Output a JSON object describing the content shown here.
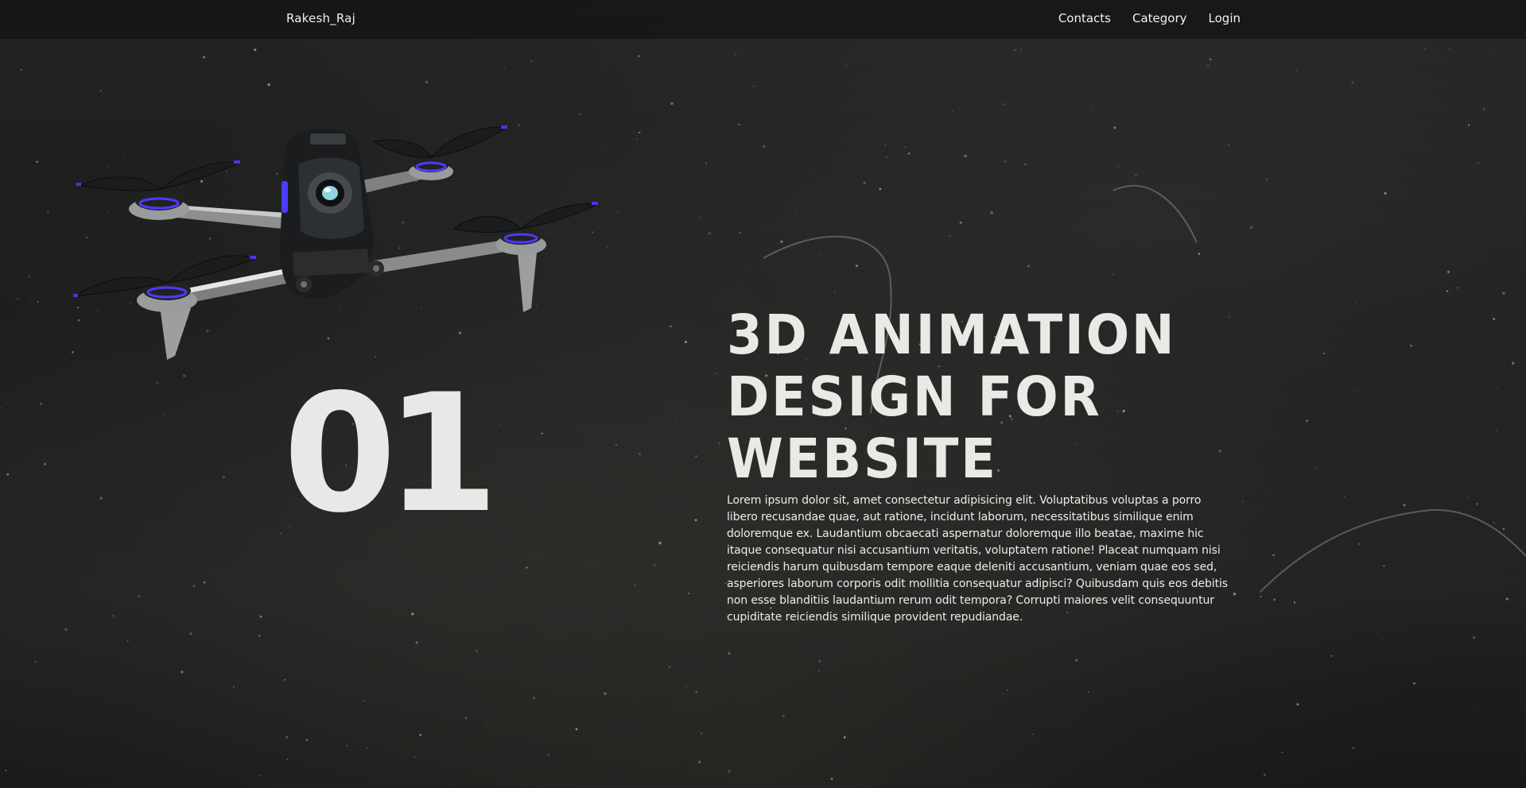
{
  "nav": {
    "brand": "Rakesh_Raj",
    "links": [
      {
        "label": "Contacts"
      },
      {
        "label": "Category"
      },
      {
        "label": "Login"
      }
    ]
  },
  "hero": {
    "number": "01",
    "headline": "3D Animation Design for Website",
    "body": "Lorem ipsum dolor sit, amet consectetur adipisicing elit. Voluptatibus voluptas a porro libero recusandae quae, aut ratione, incidunt laborum, necessitatibus similique enim doloremque ex. Laudantium obcaecati aspernatur doloremque illo beatae, maxime hic itaque consequatur nisi accusantium veritatis, voluptatem ratione! Placeat numquam nisi reiciendis harum quibusdam tempore eaque deleniti accusantium, veniam quae eos sed, asperiores laborum corporis odit mollitia consequatur adipisci? Quibusdam quis eos debitis non esse blanditiis laudantium rerum odit tempora? Corrupti maiores velit consequuntur cupiditate reiciendis similique provident repudiandae."
  },
  "colors": {
    "background": "#1b1c1b",
    "text": "#e9eae6",
    "navbar": "#161717",
    "drone_accent": "#4a3cff"
  },
  "icons": {
    "drone": "drone-3d-model"
  }
}
